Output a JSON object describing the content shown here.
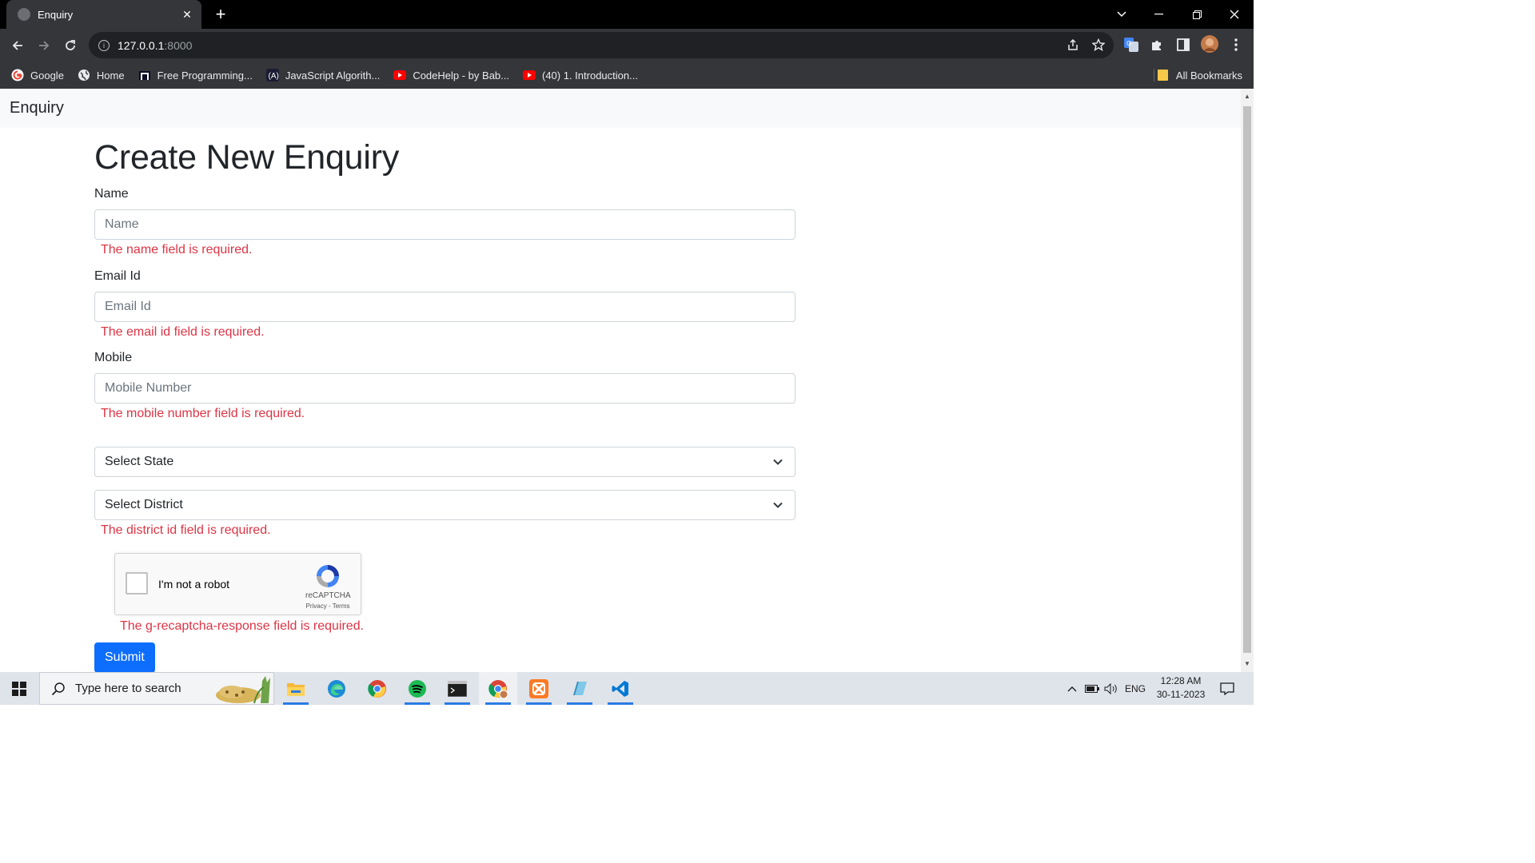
{
  "browser": {
    "tab_title": "Enquiry",
    "tab_close": "✕",
    "new_tab": "+",
    "address_host": "127.0.0.1",
    "address_port": ":8000",
    "bookmarks": [
      {
        "label": "Google",
        "icon": "google-icon"
      },
      {
        "label": "Home",
        "icon": "globe-icon"
      },
      {
        "label": "Free Programming...",
        "icon": "freecodecamp-icon"
      },
      {
        "label": "JavaScript Algorith...",
        "icon": "code-icon"
      },
      {
        "label": "CodeHelp - by Bab...",
        "icon": "youtube-icon"
      },
      {
        "label": "(40) 1. Introduction...",
        "icon": "youtube-icon"
      }
    ],
    "all_bookmarks": "All Bookmarks"
  },
  "page": {
    "brand": "Enquiry",
    "heading": "Create New Enquiry",
    "name_label": "Name",
    "name_placeholder": "Name",
    "name_error": "The name field is required.",
    "email_label": "Email Id",
    "email_placeholder": "Email Id",
    "email_error": "The email id field is required.",
    "mobile_label": "Mobile",
    "mobile_placeholder": "Mobile Number",
    "mobile_error": "The mobile number field is required.",
    "state_select": "Select State",
    "district_select": "Select District",
    "district_error": "The district id field is required.",
    "captcha_text": "I'm not a robot",
    "captcha_brand": "reCAPTCHA",
    "captcha_links": "Privacy - Terms",
    "captcha_error": "The g-recaptcha-response field is required.",
    "submit": "Submit"
  },
  "taskbar": {
    "search_placeholder": "Type here to search",
    "language": "ENG",
    "time": "12:28 AM",
    "date": "30-11-2023"
  },
  "colors": {
    "error": "#dc3545",
    "primary": "#0d6efd",
    "chrome_dark": "#35363a"
  }
}
